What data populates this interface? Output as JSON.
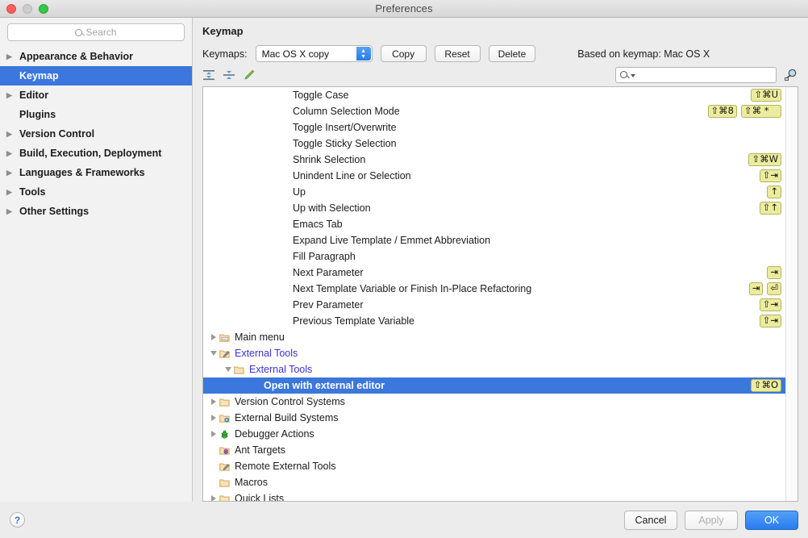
{
  "window": {
    "title": "Preferences"
  },
  "sidebar": {
    "search_placeholder": "Search",
    "items": [
      {
        "label": "Appearance & Behavior",
        "expandable": true,
        "selected": false
      },
      {
        "label": "Keymap",
        "expandable": false,
        "selected": true
      },
      {
        "label": "Editor",
        "expandable": true,
        "selected": false
      },
      {
        "label": "Plugins",
        "expandable": false,
        "selected": false
      },
      {
        "label": "Version Control",
        "expandable": true,
        "selected": false
      },
      {
        "label": "Build, Execution, Deployment",
        "expandable": true,
        "selected": false
      },
      {
        "label": "Languages & Frameworks",
        "expandable": true,
        "selected": false
      },
      {
        "label": "Tools",
        "expandable": true,
        "selected": false
      },
      {
        "label": "Other Settings",
        "expandable": true,
        "selected": false
      }
    ]
  },
  "panel": {
    "title": "Keymap",
    "keymaps_label": "Keymaps:",
    "keymap_selected": "Mac OS X copy",
    "copy_label": "Copy",
    "reset_label": "Reset",
    "delete_label": "Delete",
    "based_on": "Based on keymap: Mac OS X",
    "find_placeholder": ""
  },
  "tree": {
    "rows": [
      {
        "label": "Toggle Case",
        "indent": 4,
        "twisty": "none",
        "icon": "none",
        "shortcuts": [
          "⇧⌘U"
        ]
      },
      {
        "label": "Column Selection Mode",
        "indent": 4,
        "twisty": "none",
        "icon": "none",
        "shortcuts": [
          "⇧⌘8",
          "⇧⌘  *"
        ]
      },
      {
        "label": "Toggle Insert/Overwrite",
        "indent": 4,
        "twisty": "none",
        "icon": "none",
        "shortcuts": []
      },
      {
        "label": "Toggle Sticky Selection",
        "indent": 4,
        "twisty": "none",
        "icon": "none",
        "shortcuts": []
      },
      {
        "label": "Shrink Selection",
        "indent": 4,
        "twisty": "none",
        "icon": "none",
        "shortcuts": [
          "⇧⌘W"
        ]
      },
      {
        "label": "Unindent Line or Selection",
        "indent": 4,
        "twisty": "none",
        "icon": "none",
        "shortcuts": [
          "⇧⇥"
        ]
      },
      {
        "label": "Up",
        "indent": 4,
        "twisty": "none",
        "icon": "none",
        "shortcuts": [
          "↑"
        ]
      },
      {
        "label": "Up with Selection",
        "indent": 4,
        "twisty": "none",
        "icon": "none",
        "shortcuts": [
          "⇧↑"
        ]
      },
      {
        "label": "Emacs Tab",
        "indent": 4,
        "twisty": "none",
        "icon": "none",
        "shortcuts": []
      },
      {
        "label": "Expand Live Template / Emmet Abbreviation",
        "indent": 4,
        "twisty": "none",
        "icon": "none",
        "shortcuts": []
      },
      {
        "label": "Fill Paragraph",
        "indent": 4,
        "twisty": "none",
        "icon": "none",
        "shortcuts": []
      },
      {
        "label": "Next Parameter",
        "indent": 4,
        "twisty": "none",
        "icon": "none",
        "shortcuts": [
          "⇥"
        ]
      },
      {
        "label": "Next Template Variable or Finish In-Place Refactoring",
        "indent": 4,
        "twisty": "none",
        "icon": "none",
        "shortcuts": [
          "⇥",
          "⏎"
        ]
      },
      {
        "label": "Prev Parameter",
        "indent": 4,
        "twisty": "none",
        "icon": "none",
        "shortcuts": [
          "⇧⇥"
        ]
      },
      {
        "label": "Previous Template Variable",
        "indent": 4,
        "twisty": "none",
        "icon": "none",
        "shortcuts": [
          "⇧⇥"
        ]
      },
      {
        "label": "Main menu",
        "indent": 0,
        "twisty": "closed",
        "icon": "folder-menu",
        "shortcuts": []
      },
      {
        "label": "External Tools",
        "indent": 0,
        "twisty": "open",
        "icon": "folder-tools",
        "modified": true,
        "shortcuts": []
      },
      {
        "label": "External Tools",
        "indent": 1,
        "twisty": "open",
        "icon": "folder",
        "modified": true,
        "shortcuts": []
      },
      {
        "label": "Open with external editor",
        "indent": 2,
        "twisty": "none",
        "icon": "none",
        "selected": true,
        "shortcuts": [
          "⇧⌘O"
        ]
      },
      {
        "label": "Version Control Systems",
        "indent": 0,
        "twisty": "closed",
        "icon": "folder",
        "shortcuts": []
      },
      {
        "label": "External Build Systems",
        "indent": 0,
        "twisty": "closed",
        "icon": "folder-gear",
        "shortcuts": []
      },
      {
        "label": "Debugger Actions",
        "indent": 0,
        "twisty": "closed",
        "icon": "bug-green",
        "shortcuts": []
      },
      {
        "label": "Ant Targets",
        "indent": 0,
        "twisty": "none",
        "icon": "folder-ant",
        "shortcuts": []
      },
      {
        "label": "Remote External Tools",
        "indent": 0,
        "twisty": "none",
        "icon": "folder-tools",
        "shortcuts": []
      },
      {
        "label": "Macros",
        "indent": 0,
        "twisty": "none",
        "icon": "folder",
        "shortcuts": []
      },
      {
        "label": "Quick Lists",
        "indent": 0,
        "twisty": "closed",
        "icon": "folder",
        "shortcuts": []
      }
    ]
  },
  "toolbar_icons": [
    {
      "name": "expand-all-icon"
    },
    {
      "name": "collapse-all-icon"
    },
    {
      "name": "edit-shortcut-icon"
    }
  ],
  "footer": {
    "help_label": "?",
    "cancel_label": "Cancel",
    "apply_label": "Apply",
    "ok_label": "OK"
  },
  "colors": {
    "selection_blue": "#3b77dc",
    "badge_bg": "#ecec9e",
    "badge_border": "#b3b35f",
    "modified_text": "#3a32d2",
    "folder": "#d8a44a"
  }
}
